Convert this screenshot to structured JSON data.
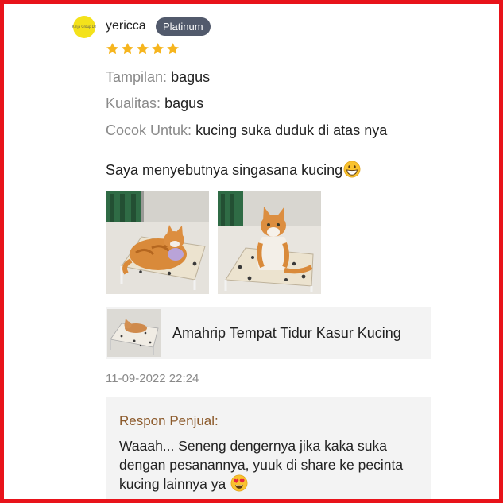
{
  "reviewer": {
    "name": "yericca",
    "badge": "Platinum",
    "avatar_text": "Kirija Group Dz",
    "rating": 5,
    "rating_max": 5
  },
  "attributes": [
    {
      "label": "Tampilan:",
      "value": "bagus"
    },
    {
      "label": "Kualitas:",
      "value": "bagus"
    },
    {
      "label": "Cocok Untuk:",
      "value": "kucing suka duduk di atas nya"
    }
  ],
  "review_text": "Saya menyebutnya singasana kucing",
  "review_emoji": "grinning-face-emoji",
  "photos": [
    "cat-lying-on-bed-photo",
    "cat-sitting-on-bed-photo"
  ],
  "product": {
    "name": "Amahrip Tempat Tidur Kasur Kucing",
    "thumbnail": "pet-bed-thumbnail"
  },
  "timestamp": "11-09-2022 22:24",
  "seller_response": {
    "title": "Respon Penjual:",
    "text": "Waaah... Seneng dengernya jika kaka suka dengan pesanannya, yuuk di share ke pecinta kucing lainnya ya",
    "emoji": "heart-eyes-emoji"
  },
  "colors": {
    "border": "#e8131a",
    "star": "#f6b51e",
    "badge_bg": "#525a6c",
    "avatar_bg": "#f4e21b",
    "label_gray": "#8a8a8a",
    "seller_title": "#8c5a2b",
    "card_bg": "#f3f3f3"
  }
}
